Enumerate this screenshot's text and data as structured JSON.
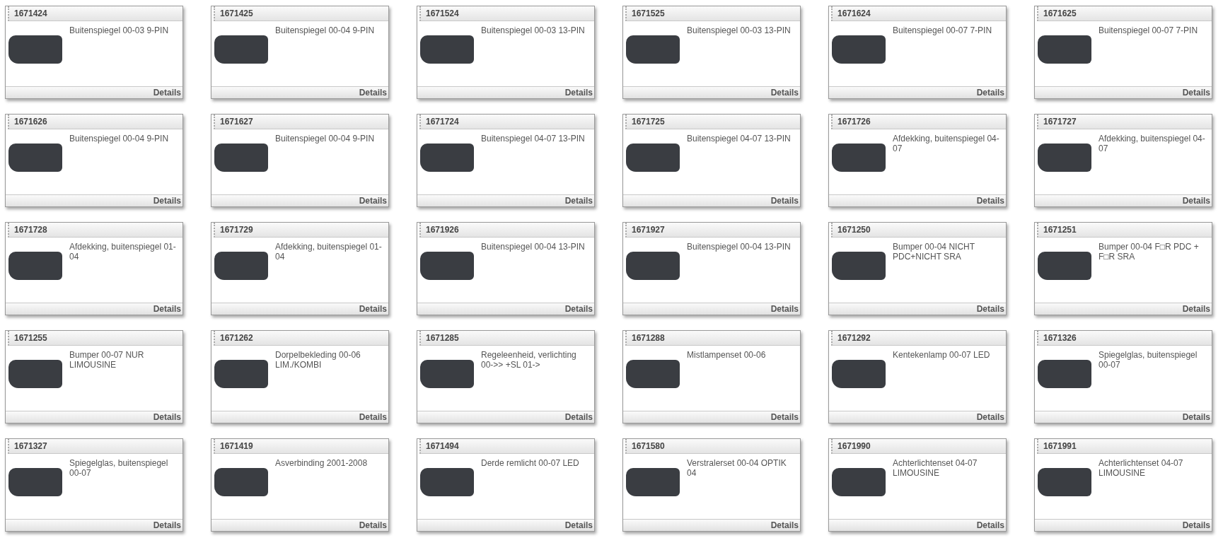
{
  "products": [
    {
      "number": "1671424",
      "title": "Buitenspiegel 00-03 9-PIN",
      "link": "Details"
    },
    {
      "number": "1671425",
      "title": "Buitenspiegel 00-04 9-PIN",
      "link": "Details"
    },
    {
      "number": "1671524",
      "title": "Buitenspiegel 00-03 13-PIN",
      "link": "Details"
    },
    {
      "number": "1671525",
      "title": "Buitenspiegel 00-03 13-PIN",
      "link": "Details"
    },
    {
      "number": "1671624",
      "title": "Buitenspiegel 00-07 7-PIN",
      "link": "Details"
    },
    {
      "number": "1671625",
      "title": "Buitenspiegel 00-07 7-PIN",
      "link": "Details"
    },
    {
      "number": "1671626",
      "title": "Buitenspiegel 00-04 9-PIN",
      "link": "Details"
    },
    {
      "number": "1671627",
      "title": "Buitenspiegel 00-04 9-PIN",
      "link": "Details"
    },
    {
      "number": "1671724",
      "title": "Buitenspiegel 04-07 13-PIN",
      "link": "Details"
    },
    {
      "number": "1671725",
      "title": "Buitenspiegel 04-07 13-PIN",
      "link": "Details"
    },
    {
      "number": "1671726",
      "title": "Afdekking, buitenspiegel 04-07",
      "link": "Details"
    },
    {
      "number": "1671727",
      "title": "Afdekking, buitenspiegel 04-07",
      "link": "Details"
    },
    {
      "number": "1671728",
      "title": "Afdekking, buitenspiegel 01-04",
      "link": "Details"
    },
    {
      "number": "1671729",
      "title": "Afdekking, buitenspiegel 01-04",
      "link": "Details"
    },
    {
      "number": "1671926",
      "title": "Buitenspiegel 00-04 13-PIN",
      "link": "Details"
    },
    {
      "number": "1671927",
      "title": "Buitenspiegel 00-04 13-PIN",
      "link": "Details"
    },
    {
      "number": "1671250",
      "title": "Bumper 00-04 NICHT PDC+NICHT SRA",
      "link": "Details"
    },
    {
      "number": "1671251",
      "title": "Bumper 00-04 F□R PDC + F□R SRA",
      "link": "Details"
    },
    {
      "number": "1671255",
      "title": "Bumper 00-07 NUR LIMOUSINE",
      "link": "Details"
    },
    {
      "number": "1671262",
      "title": "Dorpelbekleding 00-06 LIM./KOMBI",
      "link": "Details"
    },
    {
      "number": "1671285",
      "title": "Regeleenheid, verlichting 00->> +SL 01->",
      "link": "Details"
    },
    {
      "number": "1671288",
      "title": "Mistlampenset 00-06",
      "link": "Details"
    },
    {
      "number": "1671292",
      "title": "Kentekenlamp 00-07 LED",
      "link": "Details"
    },
    {
      "number": "1671326",
      "title": "Spiegelglas, buitenspiegel 00-07",
      "link": "Details"
    },
    {
      "number": "1671327",
      "title": "Spiegelglas, buitenspiegel 00-07",
      "link": "Details"
    },
    {
      "number": "1671419",
      "title": "Asverbinding 2001-2008",
      "link": "Details"
    },
    {
      "number": "1671494",
      "title": "Derde remlicht 00-07 LED",
      "link": "Details"
    },
    {
      "number": "1671580",
      "title": "Verstralerset 00-04 OPTIK 04",
      "link": "Details"
    },
    {
      "number": "1671990",
      "title": "Achterlichtenset 04-07 LIMOUSINE",
      "link": "Details"
    },
    {
      "number": "1671991",
      "title": "Achterlichtenset 04-07 LIMOUSINE",
      "link": "Details"
    }
  ]
}
